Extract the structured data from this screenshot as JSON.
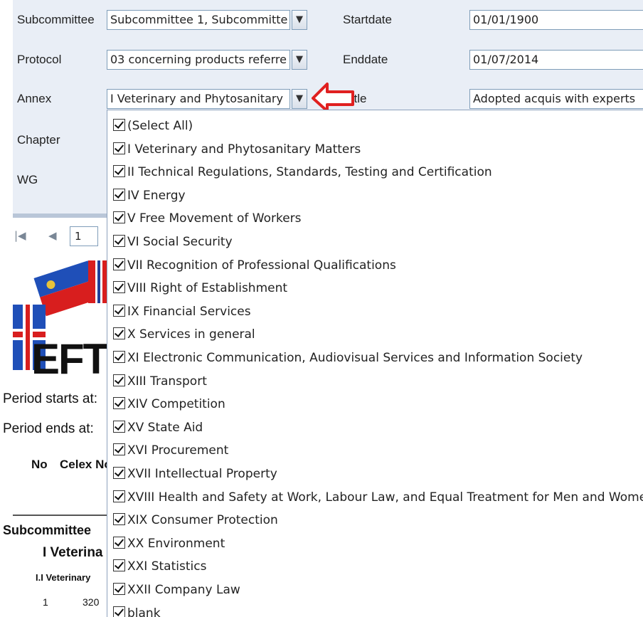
{
  "params": {
    "subcommittee": {
      "label": "Subcommittee",
      "value": "Subcommittee 1, Subcommitte"
    },
    "protocol": {
      "label": "Protocol",
      "value": "03 concerning products referre"
    },
    "annex": {
      "label": "Annex",
      "value": "I Veterinary and Phytosanitary"
    },
    "chapter": {
      "label": "Chapter"
    },
    "wg": {
      "label": "WG"
    },
    "startdate": {
      "label": "Startdate",
      "value": "01/01/1900"
    },
    "enddate": {
      "label": "Enddate",
      "value": "01/07/2014"
    },
    "title": {
      "label": "Title",
      "value": "Adopted acquis with experts"
    }
  },
  "toolbar": {
    "page_value": "1",
    "first_icon": "first-page-icon",
    "prev_icon": "prev-page-icon"
  },
  "report": {
    "logo_text": "EFT",
    "period_starts": "Period starts at:",
    "period_ends": "Period ends at:",
    "col_no": "No",
    "col_celex": "Celex No",
    "subcommittee_heading": "Subcommittee",
    "annex_heading": "I Veterina",
    "chapter_heading": "I.I Veterinary",
    "row_no": "1",
    "row_celex": "320"
  },
  "annex_options": [
    "(Select All)",
    "I Veterinary and Phytosanitary Matters",
    "II Technical Regulations, Standards, Testing and Certification",
    "IV Energy",
    "V Free Movement of Workers",
    "VI Social Security",
    "VII Recognition of Professional Qualifications",
    "VIII Right of Establishment",
    "IX Financial Services",
    "X Services in general",
    "XI Electronic Communication, Audiovisual Services and Information Society",
    "XIII Transport",
    "XIV Competition",
    "XV State Aid",
    "XVI Procurement",
    "XVII Intellectual Property",
    "XVIII Health and Safety at Work, Labour Law, and Equal Treatment for Men and Women",
    "XIX Consumer Protection",
    "XX Environment",
    "XXI Statistics",
    "XXII Company Law",
    "blank"
  ],
  "colors": {
    "panel_bg": "#e9eef6",
    "field_border": "#7f9db9",
    "annotation_arrow": "#e02020"
  }
}
